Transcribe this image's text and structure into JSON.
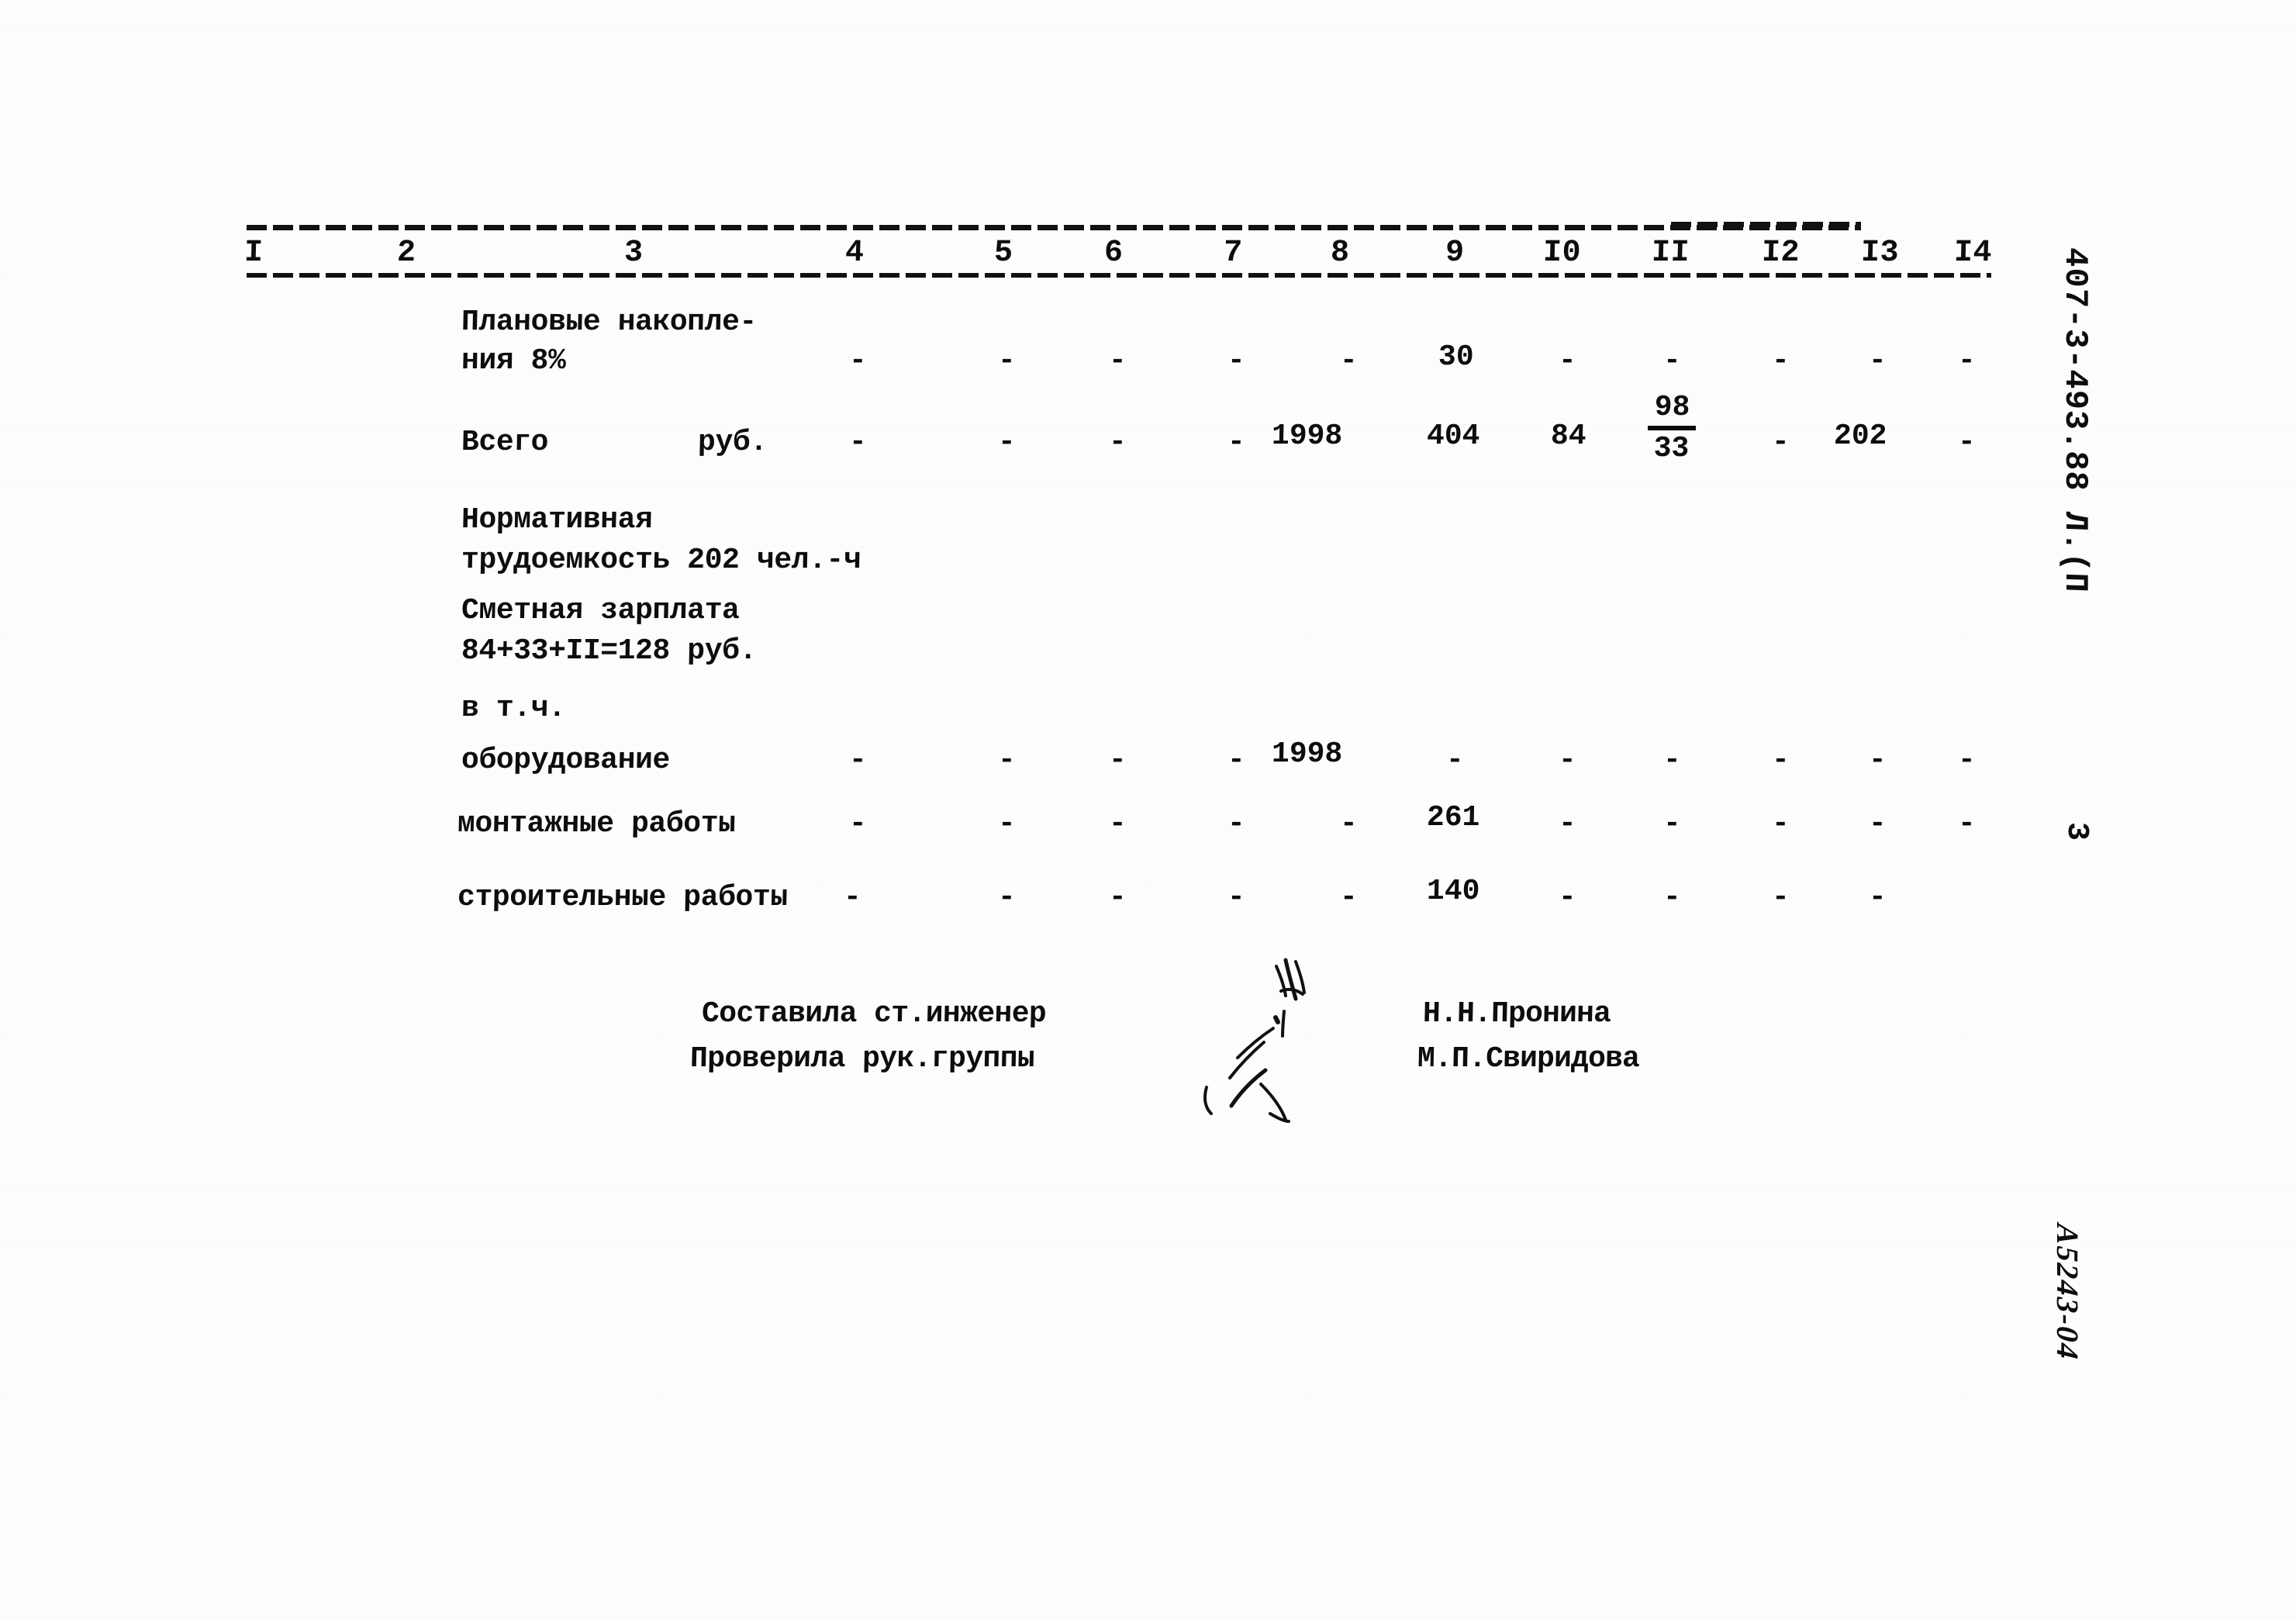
{
  "document": {
    "kind": "scanned-estimate-sheet",
    "doc_code": "407-3-493.88 Л.(П",
    "page_number": "3",
    "archive_code": "А5243-04"
  },
  "table": {
    "column_headers": [
      "I",
      "2",
      "3",
      "4",
      "5",
      "6",
      "7",
      "8",
      "9",
      "I0",
      "II",
      "I2",
      "I3",
      "I4"
    ],
    "rows": [
      {
        "label_line1": "Плановые накопле-",
        "label_line2": "ния 8%",
        "c4": "-",
        "c5": "-",
        "c6": "-",
        "c7": "-",
        "c8": "-",
        "c9": "30",
        "c10": "-",
        "c11": "-",
        "c12": "-",
        "c13": "-",
        "c14": "-"
      },
      {
        "label_line1": "Всего",
        "label_unit": "руб.",
        "c4": "-",
        "c5": "-",
        "c6": "-",
        "c7": "-",
        "c8": "1998",
        "c9": "404",
        "c10": "84",
        "c11_top": "98",
        "c11_bottom": "33",
        "c12": "-",
        "c13": "202",
        "c14": "-"
      },
      {
        "label_line1": "оборудование",
        "c4": "-",
        "c5": "-",
        "c6": "-",
        "c7": "-",
        "c8": "1998",
        "c9": "-",
        "c10": "-",
        "c11": "-",
        "c12": "-",
        "c13": "-",
        "c14": "-"
      },
      {
        "label_line1": "монтажные работы",
        "c4": "-",
        "c5": "-",
        "c6": "-",
        "c7": "-",
        "c8": "-",
        "c9": "261",
        "c10": "-",
        "c11": "-",
        "c12": "-",
        "c13": "-",
        "c14": "-"
      },
      {
        "label_line1": "строительные работы",
        "c4": "-",
        "c5": "-",
        "c6": "-",
        "c7": "-",
        "c8": "-",
        "c9": "140",
        "c10": "-",
        "c11": "-",
        "c12": "-",
        "c13": "-",
        "c14": "-"
      }
    ]
  },
  "notes": {
    "labor_line1": "Нормативная",
    "labor_line2": "трудоемкость 202 чел.-ч",
    "salary_line1": "Сметная зарплата",
    "salary_line2": "84+33+II=128 руб.",
    "including_label": "в т.ч."
  },
  "signatures": {
    "composed_role": "Составила ст.инженер",
    "composed_name": "Н.Н.Пронина",
    "checked_role": "Проверила рук.группы",
    "checked_name": "М.П.Свиридова"
  }
}
